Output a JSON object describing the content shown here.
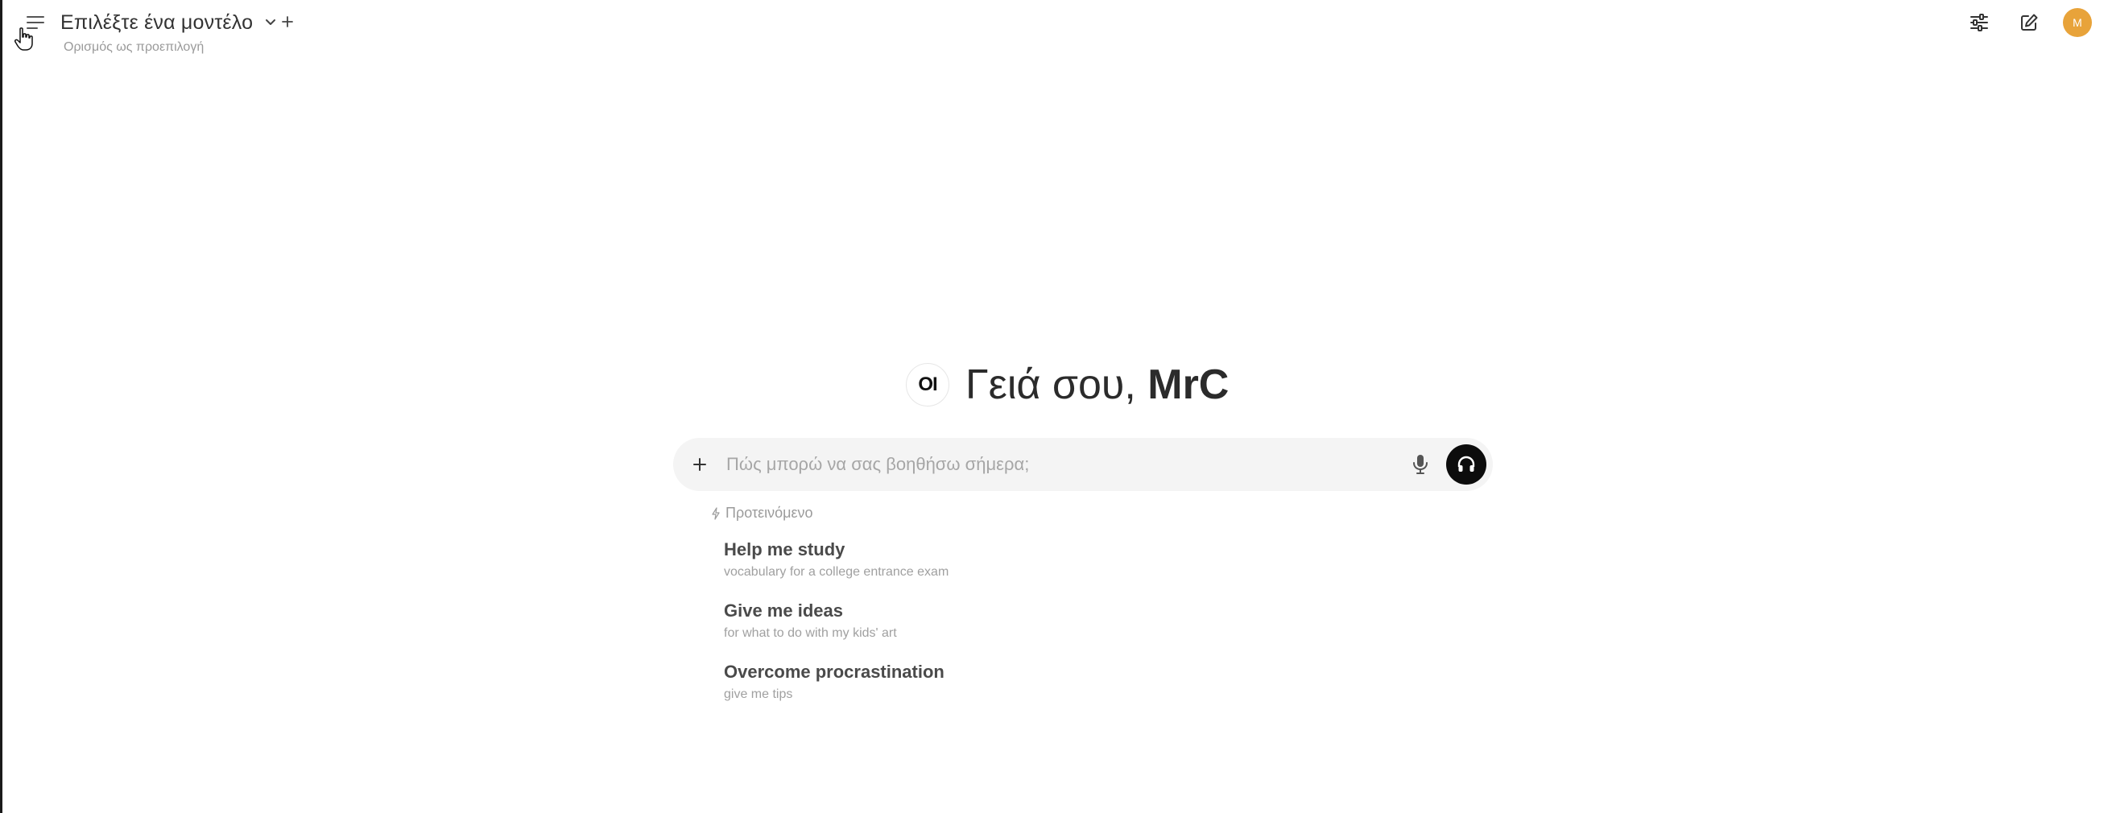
{
  "header": {
    "menu_icon": "hamburger-icon",
    "model_name": "Επιλέξτε ένα μοντέλο",
    "set_default": "Ορισμός ως προεπιλογή",
    "controls_icon": "sliders-icon",
    "new_chat_icon": "pencil-square-icon",
    "avatar_letter": "M",
    "avatar_color": "#e8a33a"
  },
  "greeting": {
    "logo_text": "OI",
    "hello": "Γειά σου,",
    "user": "MrC"
  },
  "chat": {
    "placeholder": "Πώς μπορώ να σας βοηθήσω σήμερα;"
  },
  "suggestions": {
    "heading": "Προτεινόμενο",
    "items": [
      {
        "title": "Help me study",
        "subtitle": "vocabulary for a college entrance exam"
      },
      {
        "title": "Give me ideas",
        "subtitle": "for what to do with my kids' art"
      },
      {
        "title": "Overcome procrastination",
        "subtitle": "give me tips"
      }
    ]
  }
}
